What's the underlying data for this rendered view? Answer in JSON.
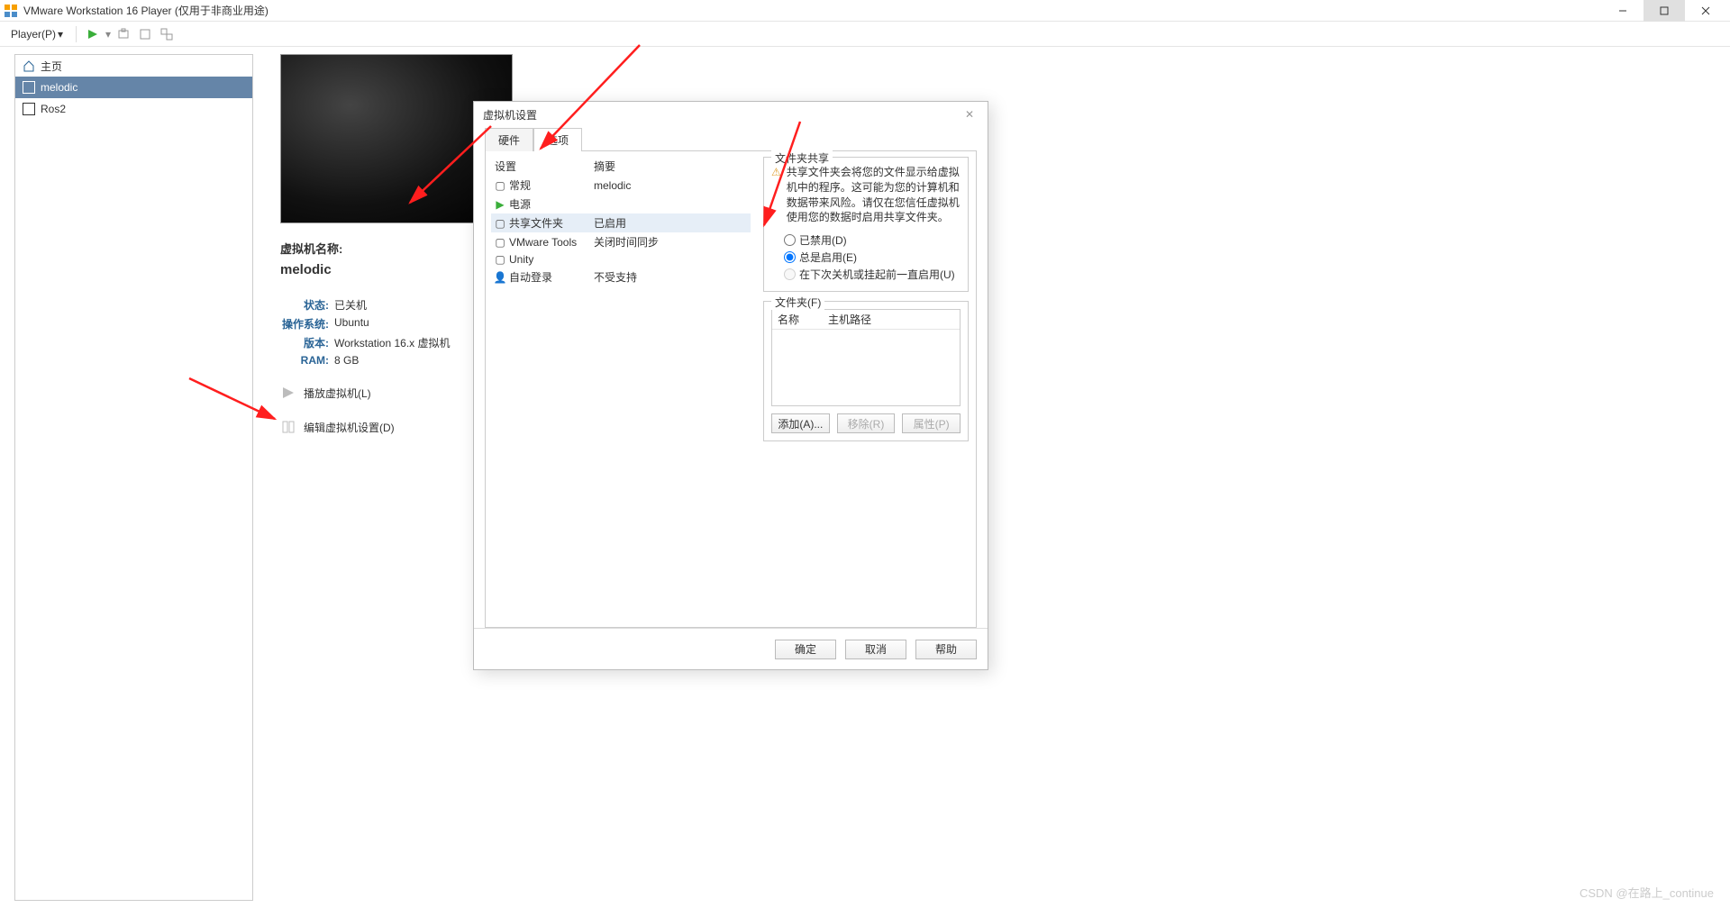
{
  "window": {
    "title": "VMware Workstation 16 Player (仅用于非商业用途)"
  },
  "toolbar": {
    "player_menu": "Player(P)"
  },
  "sidebar": {
    "home": "主页",
    "items": [
      {
        "label": "melodic"
      },
      {
        "label": "Ros2"
      }
    ]
  },
  "vm": {
    "name_label": "虚拟机名称:",
    "name": "melodic",
    "status_k": "状态:",
    "status_v": "已关机",
    "os_k": "操作系统:",
    "os_v": "Ubuntu",
    "ver_k": "版本:",
    "ver_v": "Workstation 16.x 虚拟机",
    "ram_k": "RAM:",
    "ram_v": "8 GB",
    "play": "播放虚拟机(L)",
    "edit": "编辑虚拟机设置(D)"
  },
  "dialog": {
    "title": "虚拟机设置",
    "tabs": {
      "hw": "硬件",
      "opt": "选项"
    },
    "headers": {
      "setting": "设置",
      "summary": "摘要"
    },
    "rows": [
      {
        "label": "常规",
        "summary": "melodic"
      },
      {
        "label": "电源",
        "summary": ""
      },
      {
        "label": "共享文件夹",
        "summary": "已启用"
      },
      {
        "label": "VMware Tools",
        "summary": "关闭时间同步"
      },
      {
        "label": "Unity",
        "summary": ""
      },
      {
        "label": "自动登录",
        "summary": "不受支持"
      }
    ],
    "share": {
      "group": "文件夹共享",
      "warn": "共享文件夹会将您的文件显示给虚拟机中的程序。这可能为您的计算机和数据带来风险。请仅在您信任虚拟机使用您的数据时启用共享文件夹。",
      "r_disabled": "已禁用(D)",
      "r_always": "总是启用(E)",
      "r_until": "在下次关机或挂起前一直启用(U)"
    },
    "folders": {
      "group": "文件夹(F)",
      "col_name": "名称",
      "col_path": "主机路径",
      "add": "添加(A)...",
      "remove": "移除(R)",
      "props": "属性(P)"
    },
    "buttons": {
      "ok": "确定",
      "cancel": "取消",
      "help": "帮助"
    }
  },
  "watermark": "CSDN @在路上_continue"
}
